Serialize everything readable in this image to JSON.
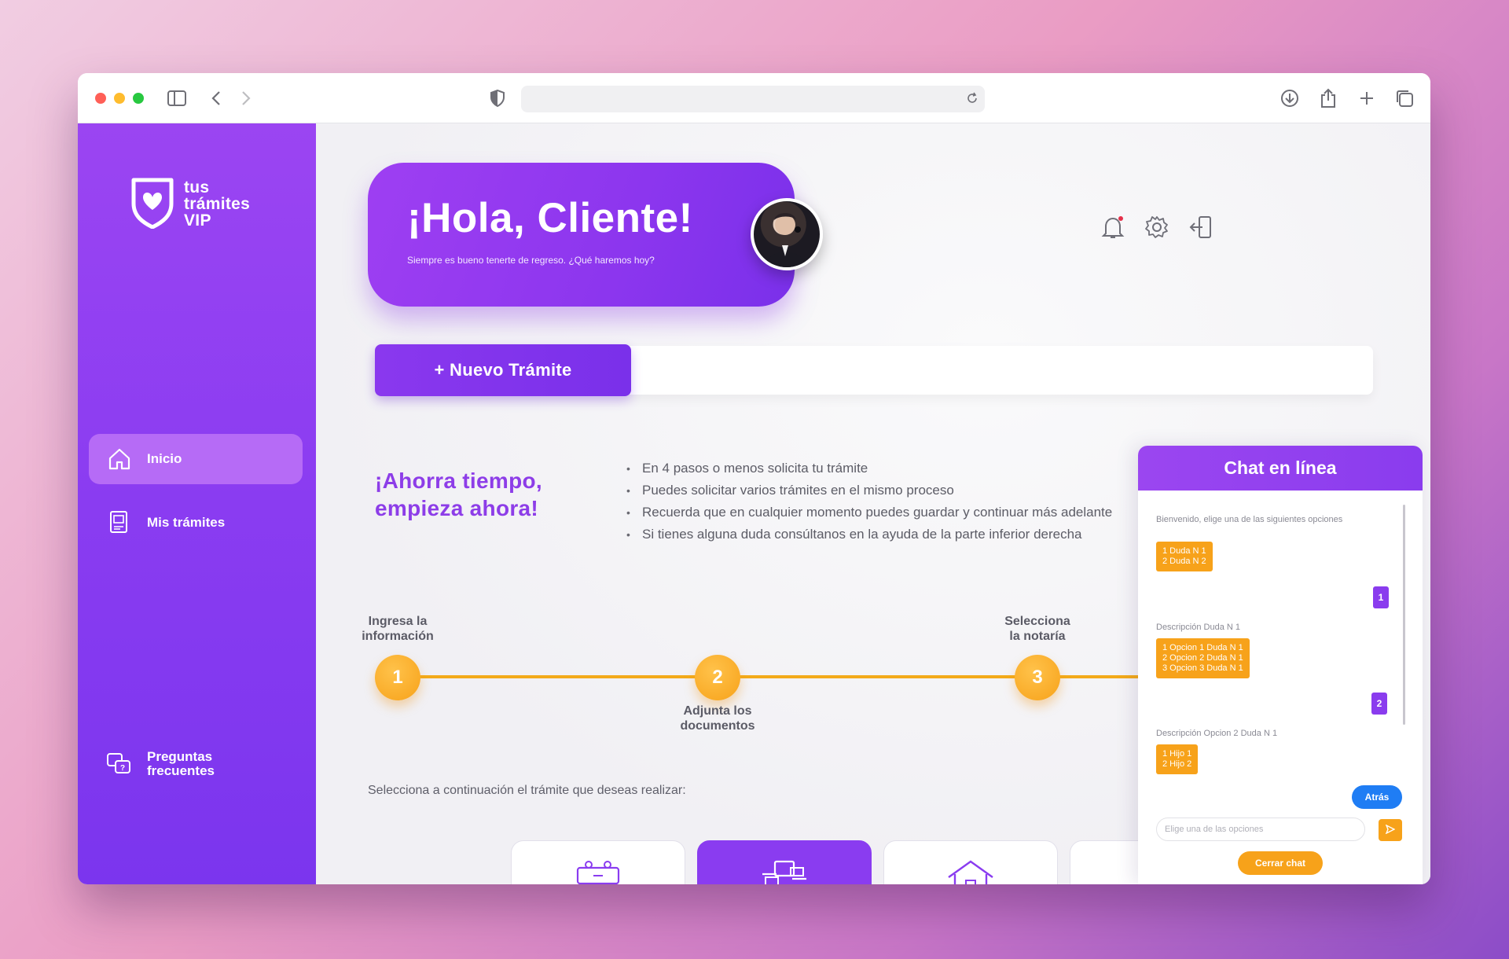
{
  "app": {
    "brand": "tus\ntrámites\nVIP"
  },
  "browser": {
    "address": ""
  },
  "sidebar": {
    "items": [
      {
        "label": "Inicio",
        "icon": "home-icon",
        "active": true
      },
      {
        "label": "Mis trámites",
        "icon": "documents-icon",
        "active": false
      }
    ],
    "footer": {
      "label": "Preguntas\nfrecuentes",
      "icon": "faq-icon"
    }
  },
  "hero": {
    "greeting": "¡Hola, Cliente!",
    "subtitle": "Siempre es bueno tenerte de regreso. ¿Qué haremos hoy?"
  },
  "header_icons": [
    "bell-icon",
    "gear-icon",
    "logout-icon"
  ],
  "new_tramite": {
    "label": "+ Nuevo Trámite"
  },
  "tagline": "¡Ahorra tiempo,\nempieza ahora!",
  "tips": [
    "En 4 pasos o menos solicita tu trámite",
    "Puedes solicitar varios trámites en el mismo proceso",
    "Recuerda que en cualquier momento puedes guardar y continuar más adelante",
    "Si tienes alguna duda consúltanos en la ayuda de la parte inferior derecha"
  ],
  "steps": [
    {
      "num": "1",
      "label": "Ingresa la\ninformación"
    },
    {
      "num": "2",
      "label": "Adjunta los\ndocumentos"
    },
    {
      "num": "3",
      "label": "Selecciona\nla notaría"
    }
  ],
  "select_prompt": "Selecciona a continuación el trámite que deseas realizar:",
  "cards": [
    {
      "icon": "family-icon",
      "selected": false
    },
    {
      "icon": "transfer-icon",
      "selected": true
    },
    {
      "icon": "house-icon",
      "selected": false
    },
    {
      "icon": "partial-icon",
      "selected": false
    }
  ],
  "chat": {
    "title": "Chat en línea",
    "welcome": "Bienvenido, elige una de las siguientes opciones",
    "options1": "1 Duda N 1\n2 Duda N 2",
    "reply1": "1",
    "desc1": "Descripción Duda N 1",
    "options2": "1 Opcion 1 Duda N 1\n2 Opcion 2 Duda N 1\n3 Opcion 3 Duda N 1",
    "reply2": "2",
    "desc2": "Descripción Opcion 2 Duda N 1",
    "options3": "1 Hijo 1\n2 Hijo 2",
    "back": "Atrás",
    "input_placeholder": "Elige una de las opciones",
    "close": "Cerrar chat"
  },
  "colors": {
    "primary": "#8a3cf0",
    "accent": "#f7a21a",
    "blue": "#1f7df4"
  }
}
